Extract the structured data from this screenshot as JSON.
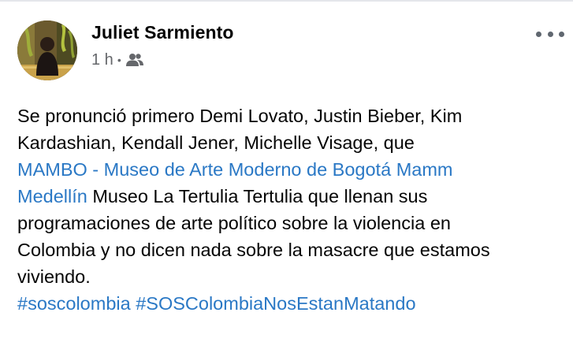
{
  "post": {
    "author": "Juliet Sarmiento",
    "time": "1 h",
    "audience_icon": "friends-icon",
    "more_icon": "more-options-icon",
    "colors": {
      "text": "#050505",
      "secondary": "#65676b",
      "link": "#2a78c5"
    },
    "lines": [
      [
        {
          "text": "Se pronunció primero Demi Lovato, Justin Bieber, Kim",
          "link": false
        }
      ],
      [
        {
          "text": "Kardashian, Kendall Jener, Michelle Visage,  que",
          "link": false
        }
      ],
      [
        {
          "text": "MAMBO - Museo de Arte Moderno de Bogotá",
          "link": true
        },
        {
          "text": " ",
          "link": false
        },
        {
          "text": "Mamm",
          "link": true
        }
      ],
      [
        {
          "text": "Medellín",
          "link": true
        },
        {
          "text": " Museo La Tertulia Tertulia que llenan sus",
          "link": false
        }
      ],
      [
        {
          "text": "programaciones de arte político sobre la violencia en",
          "link": false
        }
      ],
      [
        {
          "text": "Colombia y no dicen nada sobre la masacre que estamos",
          "link": false
        }
      ],
      [
        {
          "text": "viviendo.",
          "link": false
        }
      ],
      [
        {
          "text": "#soscolombia",
          "link": true
        },
        {
          "text": " ",
          "link": false
        },
        {
          "text": "#SOSColombiaNosEstanMatando",
          "link": true
        }
      ]
    ]
  }
}
